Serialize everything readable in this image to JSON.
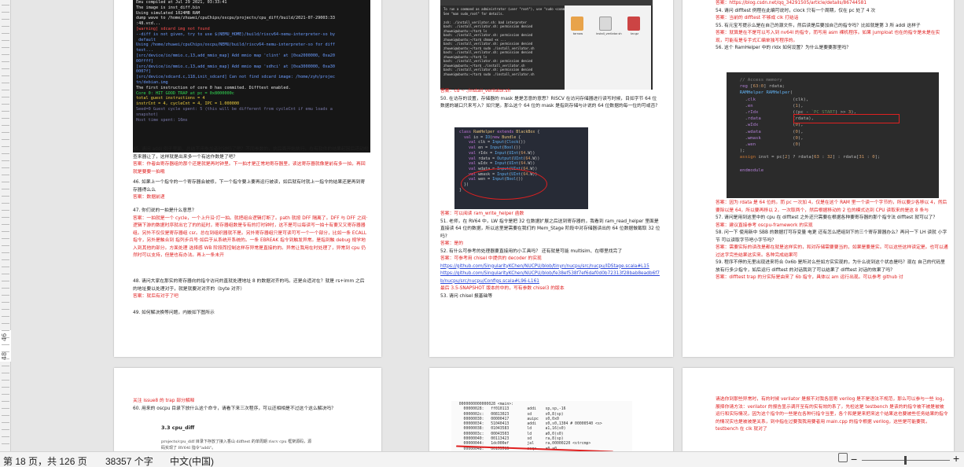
{
  "ruler": {
    "labels": [
      "46",
      "48"
    ]
  },
  "page1": {
    "terminal_lines": [
      {
        "t": "Emu compiled at Jul 29 2021, 03:33:41",
        "c": "t-w"
      },
      {
        "t": "The image is inst_diff.bin",
        "c": "t-w"
      },
      {
        "t": "Using simulated 1024MB RAM",
        "c": "t-w"
      },
      {
        "t": "dump wave to /home/zhuwei/cpuChips/oscpu/projects/cpu_diff/build/2021-07-29003:33",
        "c": "t-w"
      },
      {
        "t": ":48.vcd...",
        "c": "t-w"
      },
      {
        "t": "[warning] sdcard img not found",
        "c": "t-r"
      },
      {
        "t": "--diff is not given, try to use $(NEMU_HOME)/build/riscv64-nemu-interpreter-so by",
        "c": "t-b"
      },
      {
        "t": " default",
        "c": "t-b"
      },
      {
        "t": "Using /home/zhuwei/cpuChips/oscpu/NEMU/build/riscv64-nemu-interpreter-so for diff",
        "c": "t-b"
      },
      {
        "t": "test...",
        "c": "t-b"
      },
      {
        "t": "[src/device/io/mmio.c,13,add_mmio_map] Add mmio map 'clint' at [0xa2000000, 0xa20",
        "c": "t-b"
      },
      {
        "t": "00ffff]",
        "c": "t-b"
      },
      {
        "t": "[src/device/io/mmio.c,13,add_mmio_map] Add mmio map 'sdhci' at [0xa3000000, 0xa30",
        "c": "t-b"
      },
      {
        "t": "0007f]",
        "c": "t-b"
      },
      {
        "t": "[src/device/sdcard.c,118,init_sdcard] Can not find sdcard image: /home/zyh/projec",
        "c": "t-b"
      },
      {
        "t": "tn/debian.img",
        "c": "t-b"
      },
      {
        "t": "The first instruction of core 0 has commited. Difftest enabled.",
        "c": "t-w"
      },
      {
        "t": "Core 0: HIT GOOD TRAP at pc = 0x8000000c",
        "c": "t-g"
      },
      {
        "t": "total guest instructions = 4",
        "c": "t-y"
      },
      {
        "t": "instrCnt = 4, cycleCnt = 4, IPC = 1.000000",
        "c": "t-y"
      },
      {
        "t": "Seed=0 Guest cycle spent: 5 (this will be different from cycleCnt if emu loads a",
        "c": "t-dim"
      },
      {
        "t": "snapshot)",
        "c": "t-dim"
      },
      {
        "t": "Host time spent: 16ms",
        "c": "t-dim"
      }
    ],
    "items": [
      {
        "q": "45. 请问 addi 例子里面，总结不用参加者时钟吗了吧？不同参数的，执后面开始执行。在有软件的结果起因后还动检查来器让了，这样就是出来多一个有这作数是了吧？",
        "a": "答案：作者由寄存器组的那个还是就是再时钟里。下一拍才是正常地寄存器里，读这寄存器就像是前有多一拍，再回就是要要一拍哦"
      },
      {
        "q": "46. 如果上一个指令的一个寄存器会被修，下一个指令要上要再运行被读，如后就有时就上一指令的结果还是再到寄存器得么么",
        "a": "答案：数据前递"
      },
      {
        "q": "47. 你们说的一拍是什么意思？",
        "a": "答案：一拍就是一个 cycle，一个上升沿·打一拍。就把组合逻辑打断了。path 就按 DFF 隔离了。DFF 与 DFF 之间·逻辑下游的数据时序就出它了的的延时，寄存器组数是专有的打时钟时，这不是可以每读写一拍十有要又又寄存器器组。另外不仅仅是寄存器组 csr。总在到组织器就不是。另外寄存器组只是可读可写一个一个部分，比如一条 ECALL 指令，另外是触合到 指列步兵号·如后于从系统开系统的。一条 EBREAK 指令到触发异常。是指到触 debug 规学地入到其他的部分。方面处理 选择感 WB 阶段而控制这样存异常是直接的的。异常让我用在时处理了，异常到 cpu 仍然时可以支持，但是也有办法。再上一条未开"
      },
      {
        "q": "48. 请问大家在那实的寄存器向的指令访问的直就处理地址 8 的数据对齐的吗。还是合适对在？就是 rs+imm 之后的地址要以处理对于，就是就要对对齐的（byte 对齐）",
        "a": "答案：就后有对于了吧"
      },
      {
        "q": "49. 如何解决换等问题，内嵌如下图所示",
        "a": ""
      }
    ]
  },
  "page2": {
    "subwin_lines": [
      "To run a command as administrator (user \"root\"), use \"sudo <command>\".",
      "See \"man sudo_root\" for details.",
      "",
      "zsh: ./install_verilator.sh: bad interpreter",
      "bash: ./install_verilator.sh: permission denied",
      "zhuwei@ubuntu:~/tar$ ls",
      "bash: ./install_verilator.sh: permission denied",
      "zhuwei@ubuntu:~/tar$ chmod +x ...",
      "bash: ./install_verilator.sh: permission denied",
      "zhuwei@ubuntu:~/tar$ sudo ./install_verilator.sh",
      "bash: ./install_verilator.sh: permission denied",
      "zhuwei@ubuntu:~/tar$ ls",
      "bash: ./install_verilator.sh: permission denied",
      "zhuwei@ubuntu:~/tar$ ./install_verilator.sh",
      "bash: ./install_verilator.sh: permission denied",
      "zhuwei@ubuntu:~/tar$ sudo ./install_verilator.sh"
    ],
    "file_labels": [
      "tarnow",
      "install_verilator.sh",
      "tar.gz"
    ],
    "answer0": "答案：cd ~ ./install_verilator.sh",
    "q50": "50. 在访存的设置，存储器的 mask 是是怎意的意思？RISCV 在访问存储器进行读写时候，目如字节 64 位数据的端口只来写入？如只是。那么这个 64 位的 mask 是指到存储与计说的 64 位数据的每一位的可或否?",
    "code_lines": [
      {
        "h": "<span class='kw'>class</span> <span class='cls'>RamHelper</span> <span class='kw'>extends</span> <span class='cls'>BlackBox</span> {"
      },
      {
        "h": "  <span class='kw'>val</span> io = <span class='fn'>IO</span>(<span class='kw'>new</span> <span class='cls'>Bundle</span> {"
      },
      {
        "h": "    <span class='kw'>val</span> clk = <span class='fn'>Input</span>(<span class='fn'>Clock</span>())"
      },
      {
        "h": "    <span class='kw'>val</span> en = <span class='fn'>Input</span>(<span class='fn'>Bool</span>())"
      },
      {
        "h": "    <span class='kw'>val</span> rIdx = <span class='fn'>Input</span>(<span class='fn'>UInt</span>(<span class='num'>64</span>.W))"
      },
      {
        "h": "    <span class='kw'>val</span> rdata = <span class='fn'>Output</span>(<span class='fn'>UInt</span>(<span class='num'>64</span>.W))"
      },
      {
        "h": "    <span class='kw'>val</span> wIdx = <span class='fn'>Input</span>(<span class='fn'>UInt</span>(<span class='num'>64</span>.W))"
      },
      {
        "h": "    <span class='kw'>val</span> wdata = <span class='fn'>Input</span>(<span class='fn'>UInt</span>(<span class='num'>64</span>.W))"
      },
      {
        "h": "    <span class='kw'>val</span> wmask = <span class='fn'>Input</span>(<span class='fn'>UInt</span>(<span class='num'>64</span>.W))"
      },
      {
        "h": "    <span class='kw'>val</span> wen = <span class='fn'>Input</span>(<span class='fn'>Bool</span>())"
      },
      {
        "h": "  })"
      },
      {
        "h": "}"
      }
    ],
    "answer50": "答案：可以阅读 ram_write_helper 函数",
    "q51": "51. 老师，在 RV64 中，LW 指令是把 32 位数据扩展之后送到寄存器的，我看到 ram_read_helper 里面是直接读 64 位的数据，所以这里是需要在我们的 Mem_Stage 阶段中对存储器读出的 64 位数据做截取 32 位吗?",
    "answer51": "答案：是的",
    "q52": "52. 有什么可参考的处理器要直接用的小工具吗？ 还有就是可能 multisim、在哪里找完了",
    "answer52": "答案：可参考用 chisel 中提供的 decoder 的实现",
    "link1": "https://github.com/SingularityKChen/NUCPU/blob/tinyn/nucpu/src/nucpu/IDStage.scala#L15",
    "link2": "https://github.com/SingularityKChen/NUCPU/blob/fe38ef538f7ef6daf0d0b72313f28bab8eadb6f7b/nucpu/src/nucpu/Configs.scala#L96-L161",
    "answer52b": "最后 3.5-SNAPSHOT 版本的中的，写有参数 chisel3 的版本",
    "q53": "53. 请问 chisel 报基础等"
  },
  "page3": {
    "answer_top": "答案：https://blog.csdn.net/qq_34291505/article/details/86744581",
    "q54": "54. 请问 difftest 例程在此编可说时，clock 只有一个周期，仅在 pc 处了 4 次",
    "answer54": "答案：当前的 difftest 不够成 clk 打结话",
    "q55": "55. 有元宝写提示么是在自己的源文件，然后读是后要加自己的指令吗？比如就是第 3 所 addi 这样子",
    "answer55": "答案：就算是在不是可以写入到 nv64I 的指令，而写用 asm 裸机程序。如果 jumploat 也在的指令是未是在实现，可能有是专手式汇编单独写程序的。",
    "q56": "56. 这个 RamHelper 中的 rIdx 如何设置？为什么是要要那里吗？",
    "code2_lines": [
      {
        "h": "  <span class='cm'>// Access memory</span>"
      },
      {
        "h": "  <span class='pu'>reg</span> [<span class='num'>63</span>:<span class='num'>0</span>] rdata;"
      },
      {
        "h": "  <span class='fn'>RAMHelper</span> <span class='fn'>RAMHelper</span>("
      },
      {
        "h": "    .<span class='pu'>clk</span>              (clk),"
      },
      {
        "h": "    .<span class='pu'>en</span>               (<span class='num'>1</span>),"
      },
      {
        "h": "    .<span class='pu'>rIdx</span>             ((pc - <span class='gr'>`PC_START</span>) >> <span class='num'>3</span>),"
      },
      {
        "h": "    .<span class='pu'>rdata</span>            (rdata),"
      },
      {
        "h": "    .<span class='pu'>wIdx</span>             (<span class='num'>0</span>),"
      },
      {
        "h": "    .<span class='pu'>wdata</span>            (<span class='num'>0</span>),"
      },
      {
        "h": "    .<span class='pu'>wmask</span>            (<span class='num'>0</span>),"
      },
      {
        "h": "    .<span class='pu'>wen</span>              (<span class='num'>0</span>)"
      },
      {
        "h": "  );"
      },
      {
        "h": "  <span class='or'>assign</span> inst = pc[<span class='num'>2</span>] ? rdata[<span class='num'>63</span> : <span class='num'>32</span>] : rdata[<span class='num'>31</span> : <span class='num'>0</span>];"
      },
      {
        "h": ""
      },
      {
        "h": "  <span class='pu'>endmodule</span>"
      }
    ],
    "answer56": "答案：因为 rdata 是 64 位的。而 pc 一次加 4，仅是在这个 RAM 里一个读一个字节的，所以要少各移以 4，然后要除以是 64，所以要再移以 2，一次取两个，然后根据移动的 2 位的模式达到 CPU 读取来的是这 8 条与",
    "q57": "57. 请问是用到这里中的 cpu 在 difftest 之外还只需要在根据各种要寄存器的那个指令法 difftest 就可以了？",
    "answer57": "答案：建议直接参考 oscpu-framework 的实现",
    "q58": "58. 问一下 使用新中 SBB 的数据打可存变量 电更 还有怎么把组到下的三个寄存算器办么？再问一下 LH 读就 小字节 可以读取字节吧小字节吗？",
    "answer58": "答案：需要实际的读改是都在就是这样实的，和对存储需要要当的，如果是要是实。可以这些这样读定是。也可以通过这字完些结果这实来。各种完成结果可",
    "q59": "59. 程序不停的无里出现进来符合 0x6b 是所对么些如方实实现的，为什么说到这个状态是吗？现在 自己的代码里放有行多少指令，如后运行 difftest 的对话我到了可以结果了 difftest 对话的效果了吗？",
    "answer59": "答案：difftest trap 的分实际是由来了 6b 指令，具体以 am 运行出现。可以参考 github 讨"
  },
  "page4": {
    "answer_top": "关注 issue8 的 trap 部分解释",
    "q60": "60. 用来的 oscpu 目录下放什么这个命令，请看下来三次程序，可以还相相是不过这个这么解决吗？",
    "heading": "3.3 cpu_diff",
    "body1": "projects/cpu_diff 目录下存放了接入香山 difftest 的单周期 riscv cpu 框架源码，源",
    "body2": "码实现了 RV64I 指令\"addi\"。"
  },
  "page5": {
    "asm_lines": [
      "  0000000000000028 <main>:",
      "    00000028:   ff010113        addi    sp,sp,-16",
      "    0000002c:   00813023        sd      s0,8(sp)",
      "    00000030:   00000417        auipc   s0,0x0",
      "    00000034:   51040413        addi    s0,s0,1304 # 00000540 <s>",
      "    00000038:   01043583        ld      a1,16(s0)",
      "    0000003c:   00043503        ld      a0,0(s0)",
      "    00000040:   00113423        sd      ra,8(sp)",
      "    00000044:   1dc000ef        jal     ra,00000220 <strcmp>",
      "    00000048:   00153513        seqz    a0,a0"
    ]
  },
  "page6": {
    "text": "请选你到那些异常时，有的时候 verilator 是报不对我各层寄 verilog 是不是语法不规范，那么可以参与一些 log，展择你请方法：verilator 的报告显示调开至有的实有效的系了，先检这是 testbench 是该的的指令被不被是被被运行和实际情况，因为这个指令的一些是在各种行指令当里，各个和是是来把来这个结果这也要被些任务结果的指令的情况实也是被被是关系，到中指在过要我我用要者用 main.cpp 的指令根据 verilog，这些是可能要我，testbench 在 clk 就对了"
  },
  "status": {
    "page": "第 18 页，共 126 页",
    "words": "38357 个字",
    "lang": "中文(中国)",
    "zoom_minus": "−",
    "zoom_plus": "+"
  }
}
